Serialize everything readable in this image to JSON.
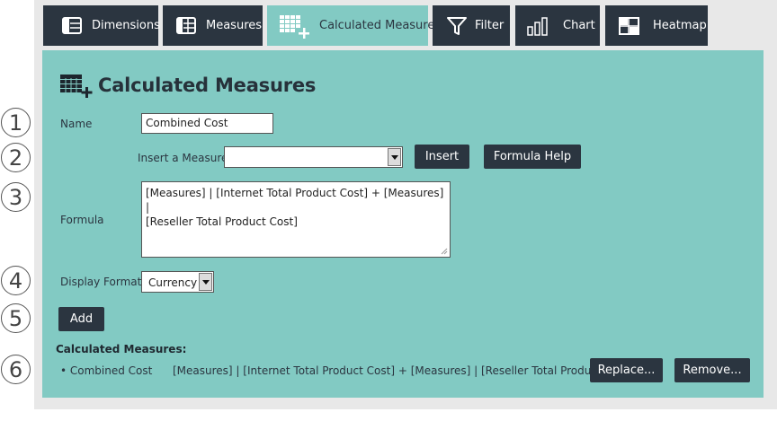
{
  "tabs": [
    {
      "label": "Dimensions",
      "icon": "dimensions-table-icon"
    },
    {
      "label": "Measures",
      "icon": "measures-table-icon"
    },
    {
      "label": "Calculated Measures",
      "icon": "calculated-measures-icon",
      "active": true
    },
    {
      "label": "Filter",
      "icon": "filter-funnel-icon"
    },
    {
      "label": "Chart",
      "icon": "bar-chart-icon"
    },
    {
      "label": "Heatmap",
      "icon": "heatmap-grid-icon"
    }
  ],
  "steps": [
    "1",
    "2",
    "3",
    "4",
    "5",
    "6"
  ],
  "panel": {
    "title": "Calculated Measures",
    "name_label": "Name",
    "name_value": "Combined Cost",
    "insert_label": "Insert a Measure",
    "insert_value": "",
    "insert_button": "Insert",
    "formula_help_button": "Formula Help",
    "formula_label": "Formula",
    "formula_line1": "[Measures] | [Internet Total Product Cost] + [Measures] |",
    "formula_line2": "[Reseller Total Product Cost]",
    "display_format_label": "Display Format",
    "display_format_value": "Currency",
    "add_button": "Add"
  },
  "list": {
    "heading": "Calculated Measures:",
    "items": [
      {
        "name": "• Combined Cost",
        "formula": "[Measures] | [Internet Total Product Cost] + [Measures] | [Reseller Total Product Cost]",
        "replace_label": "Replace...",
        "remove_label": "Remove..."
      }
    ]
  },
  "colors": {
    "panel": "#82cac3",
    "dark": "#2b3540",
    "background": "#e8e8e8"
  }
}
